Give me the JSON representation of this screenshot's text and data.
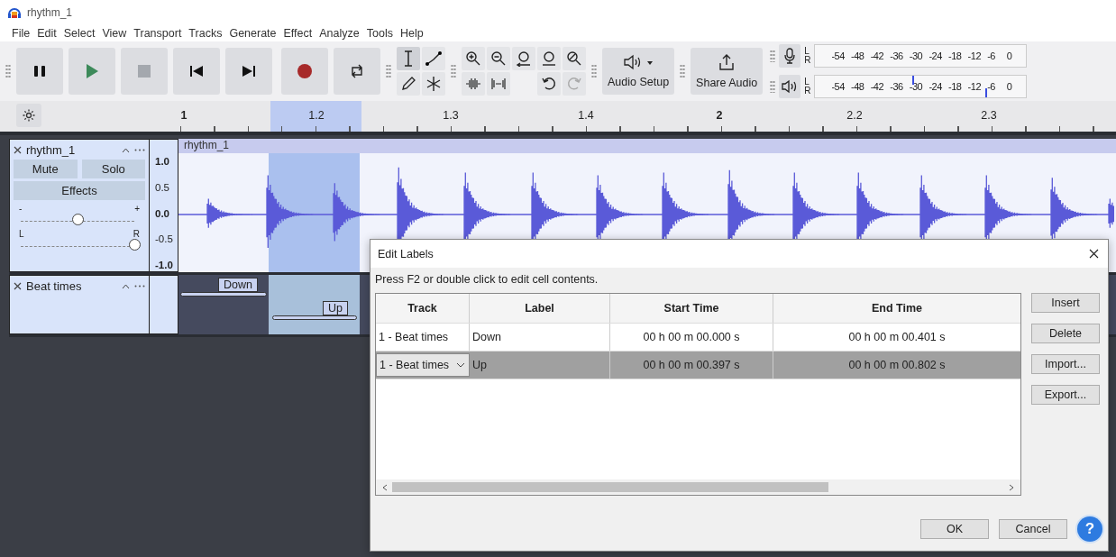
{
  "window": {
    "title": "rhythm_1"
  },
  "menu": [
    "File",
    "Edit",
    "Select",
    "View",
    "Transport",
    "Tracks",
    "Generate",
    "Effect",
    "Analyze",
    "Tools",
    "Help"
  ],
  "toolbar": {
    "audio_setup": "Audio Setup",
    "share_audio": "Share Audio",
    "meters": [
      {
        "kind": "record",
        "channels": [
          "L",
          "R"
        ],
        "ticks": [
          "-54",
          "-48",
          "-42",
          "-36",
          "-30",
          "-24",
          "-18",
          "-12",
          "-6",
          "0"
        ]
      },
      {
        "kind": "playback",
        "channels": [
          "L",
          "R"
        ],
        "ticks": [
          "-54",
          "-48",
          "-42",
          "-36",
          "-30",
          "-24",
          "-18",
          "-12",
          "-6",
          "0"
        ]
      }
    ]
  },
  "ruler": {
    "labels": [
      {
        "text": "1",
        "major": true
      },
      {
        "text": "1.2",
        "major": false
      },
      {
        "text": "1.3",
        "major": false
      },
      {
        "text": "1.4",
        "major": false
      },
      {
        "text": "2",
        "major": true
      },
      {
        "text": "2.2",
        "major": false
      },
      {
        "text": "2.3",
        "major": false
      }
    ]
  },
  "tracks": [
    {
      "kind": "audio",
      "name": "rhythm_1",
      "mute": "Mute",
      "solo": "Solo",
      "effects": "Effects",
      "gain": {
        "minus": "-",
        "plus": "+",
        "level": 0.5
      },
      "pan": {
        "left": "L",
        "right": "R",
        "level": 1.0
      },
      "scale": [
        "1.0",
        "0.5",
        "0.0",
        "-0.5",
        "-1.0"
      ],
      "clip_title": "rhythm_1"
    },
    {
      "kind": "label",
      "name": "Beat times",
      "labels": [
        "Down",
        "Up"
      ]
    }
  ],
  "dialog": {
    "title": "Edit Labels",
    "hint": "Press F2 or double click to edit cell contents.",
    "columns": [
      "Track",
      "Label",
      "Start Time",
      "End Time"
    ],
    "rows": [
      {
        "track": "1 - Beat times",
        "label": "Down",
        "start": "00 h 00 m 00.000 s",
        "end": "00 h 00 m 00.401 s",
        "selected": false,
        "editing": false
      },
      {
        "track": "1 - Beat times",
        "label": "Up",
        "start": "00 h 00 m 00.397 s",
        "end": "00 h 00 m 00.802 s",
        "selected": true,
        "editing": true
      }
    ],
    "side_buttons": [
      "Insert",
      "Delete",
      "Import...",
      "Export..."
    ],
    "ok": "OK",
    "cancel": "Cancel",
    "help": "?"
  }
}
